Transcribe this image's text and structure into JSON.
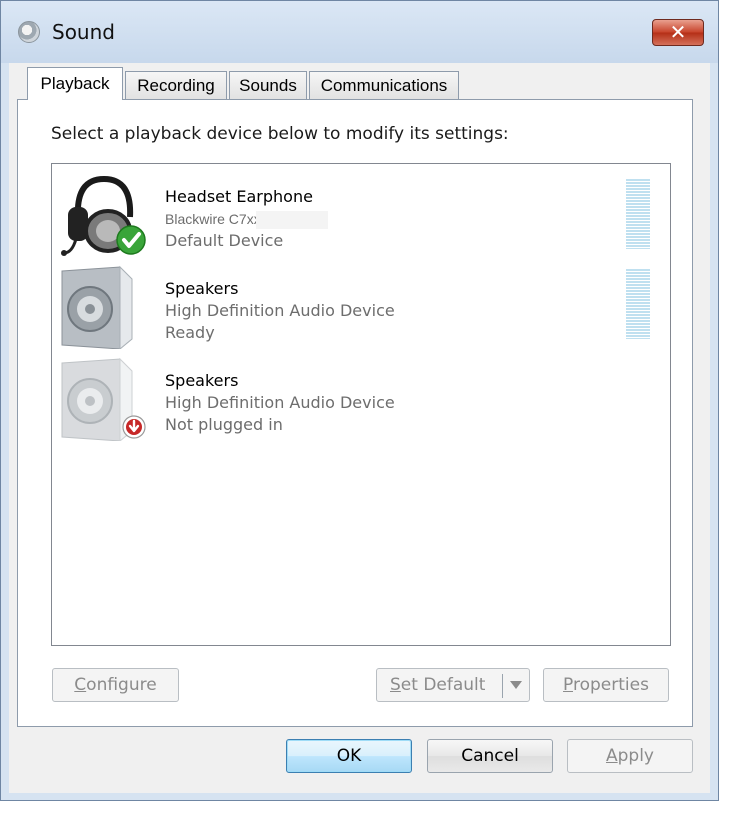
{
  "window": {
    "title": "Sound"
  },
  "tabs": [
    {
      "label": "Playback",
      "active": true
    },
    {
      "label": "Recording",
      "active": false
    },
    {
      "label": "Sounds",
      "active": false
    },
    {
      "label": "Communications",
      "active": false
    }
  ],
  "instruction": "Select a playback device below to modify its settings:",
  "devices": [
    {
      "name": "Headset Earphone",
      "description": "Blackwire C7xx",
      "status": "Default Device",
      "icon": "headset-icon",
      "badge": "default-check-icon"
    },
    {
      "name": "Speakers",
      "description": "High Definition Audio Device",
      "status": "Ready",
      "icon": "speaker-icon"
    },
    {
      "name": "Speakers",
      "description": "High Definition Audio Device",
      "status": "Not plugged in",
      "icon": "speaker-icon",
      "badge": "unplugged-arrow-icon"
    }
  ],
  "buttons": {
    "configure_pre": "",
    "configure_key": "C",
    "configure_post": "onfigure",
    "set_default_key": "S",
    "set_default_post": "et Default",
    "properties_key": "P",
    "properties_post": "roperties",
    "ok": "OK",
    "cancel": "Cancel",
    "apply_key": "A",
    "apply_post": "pply"
  },
  "colors": {
    "accent": "#3c7fb1",
    "close": "#c8452d",
    "check": "#3aa53a",
    "unplugged": "#c62828",
    "meter": "#bfe0f0"
  }
}
